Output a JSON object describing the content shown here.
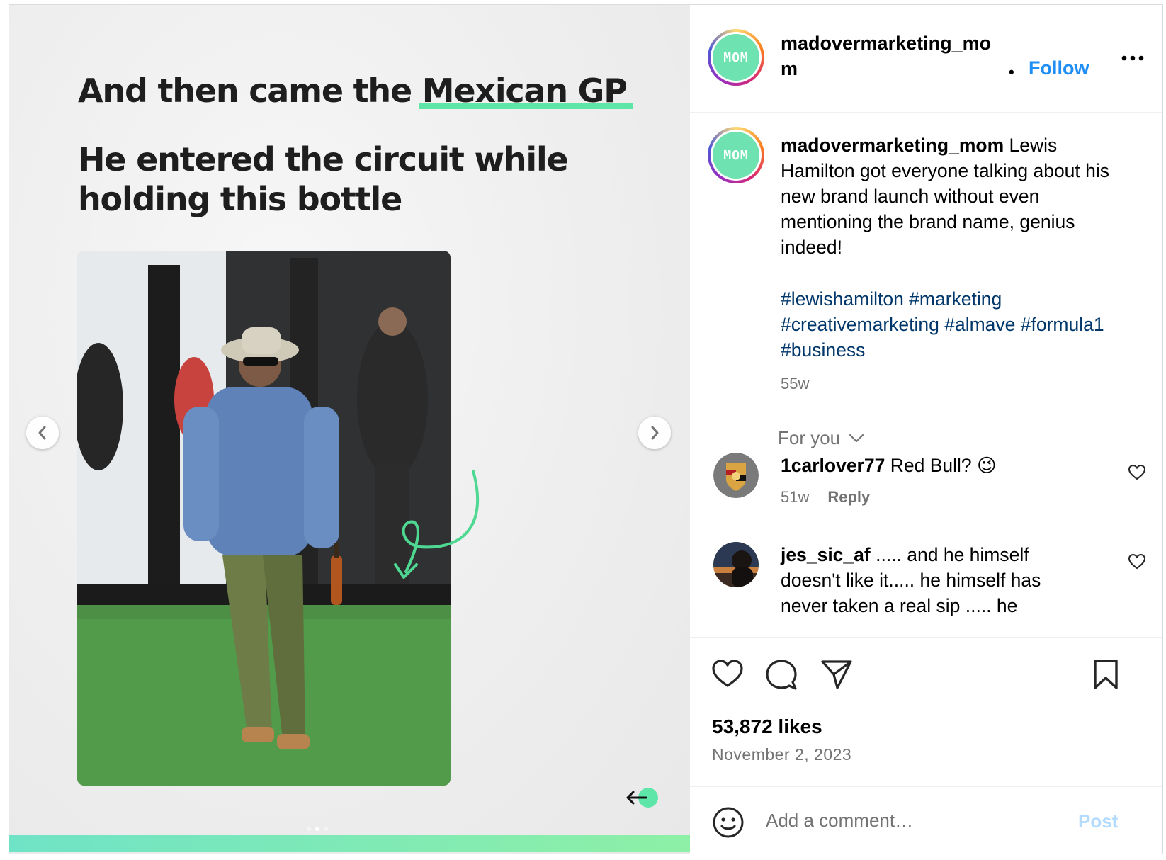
{
  "media": {
    "title_lead": "And then came the ",
    "title_highlight": "Mexican GP",
    "subtitle": "He entered the circuit while holding this bottle",
    "photo_alt": "Lewis Hamilton walking with a bottle",
    "accent_color": "#5ee6a8",
    "prev_icon": "chevron-left-icon",
    "next_icon": "chevron-right-icon",
    "slide_count": 3,
    "active_slide": 2
  },
  "header": {
    "avatar_text": "MOM",
    "username": "madovermarketing_mom",
    "separator": "•",
    "follow_label": "Follow",
    "more_icon": "more-options-icon"
  },
  "caption": {
    "avatar_text": "MOM",
    "username": "madovermarketing_mom",
    "text": "Lewis Hamilton got everyone talking about his new brand launch without even mentioning the brand name, genius indeed!",
    "hashtags": "#lewishamilton #marketing #creativemarketing #almave #formula1 #business",
    "age": "55w"
  },
  "filter": {
    "label": "For you"
  },
  "comments": [
    {
      "username": "1carlover77",
      "text": "Red Bull? 😉",
      "age": "51w",
      "reply_label": "Reply"
    },
    {
      "username": "jes_sic_af",
      "text": "..... and he himself doesn't like it..... he himself has never taken a real sip ..... he"
    }
  ],
  "actions": {
    "likes": "53,872 likes",
    "date": "November 2, 2023"
  },
  "comment_box": {
    "placeholder": "Add a comment…",
    "post_label": "Post"
  },
  "colors": {
    "link_blue": "#1f8ff5",
    "hashtag_blue": "#00376b",
    "muted": "#737373"
  }
}
